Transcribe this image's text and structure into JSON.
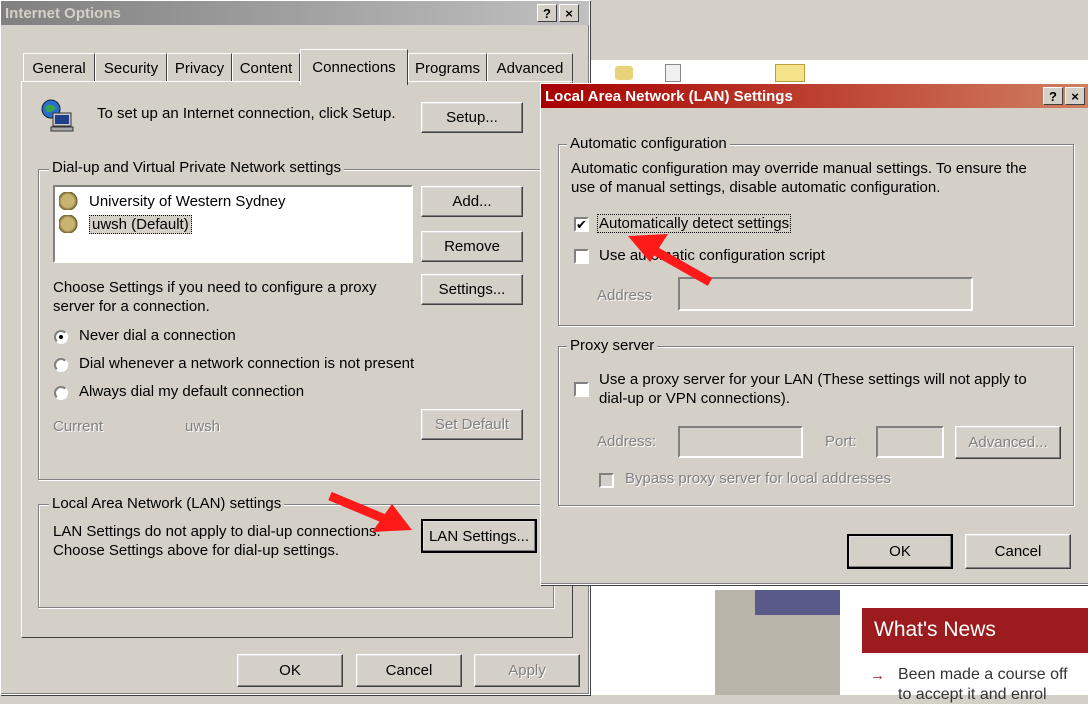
{
  "internet_options": {
    "title": "Internet Options",
    "help": "?",
    "close": "×",
    "tabs": [
      "General",
      "Security",
      "Privacy",
      "Content",
      "Connections",
      "Programs",
      "Advanced"
    ],
    "setup_text": "To set up an Internet connection, click Setup.",
    "setup_button": "Setup...",
    "dialup_group": "Dial-up and Virtual Private Network settings",
    "dialup_items": [
      "University of Western Sydney",
      "uwsh (Default)"
    ],
    "add_button": "Add...",
    "remove_button": "Remove",
    "proxy_text": "Choose Settings if you need to configure a proxy server for a connection.",
    "settings_button": "Settings...",
    "radios": [
      "Never dial a connection",
      "Dial whenever a network connection is not present",
      "Always dial my default connection"
    ],
    "radio_selected": 0,
    "current_label": "Current",
    "current_value": "uwsh",
    "set_default_button": "Set Default",
    "lan_group": "Local Area Network (LAN) settings",
    "lan_text_1": "LAN Settings do not apply to dial-up connections.",
    "lan_text_2": "Choose Settings above for dial-up settings.",
    "lan_button": "LAN Settings...",
    "ok": "OK",
    "cancel": "Cancel",
    "apply": "Apply"
  },
  "lan_dialog": {
    "title": "Local Area Network (LAN) Settings",
    "help": "?",
    "close": "×",
    "auto_group": "Automatic configuration",
    "auto_text_1": "Automatic configuration may override manual settings.  To ensure the",
    "auto_text_2": "use of manual settings, disable automatic configuration.",
    "auto_detect": "Automatically detect settings",
    "auto_detect_checked": true,
    "auto_script": "Use automatic configuration script",
    "auto_script_checked": false,
    "address_label": "Address",
    "proxy_group": "Proxy server",
    "proxy_use_1": "Use a proxy server for your LAN (These settings will not apply to",
    "proxy_use_2": "dial-up or VPN connections).",
    "proxy_checked": false,
    "proxy_address_label": "Address:",
    "proxy_port_label": "Port:",
    "advanced_button": "Advanced...",
    "bypass": "Bypass proxy server for local addresses",
    "ok": "OK",
    "cancel": "Cancel"
  },
  "background": {
    "news_title": "What's News",
    "news_item": "Been made a course off",
    "news_item_2": "to accept it and enrol"
  },
  "colors": {
    "title_active_start": "#a80000",
    "title_active_end": "#d08060",
    "title_inactive_start": "#808080",
    "title_inactive_end": "#c0c0c0",
    "arrow": "#ff0000",
    "news_bg": "#9b1b1e"
  }
}
